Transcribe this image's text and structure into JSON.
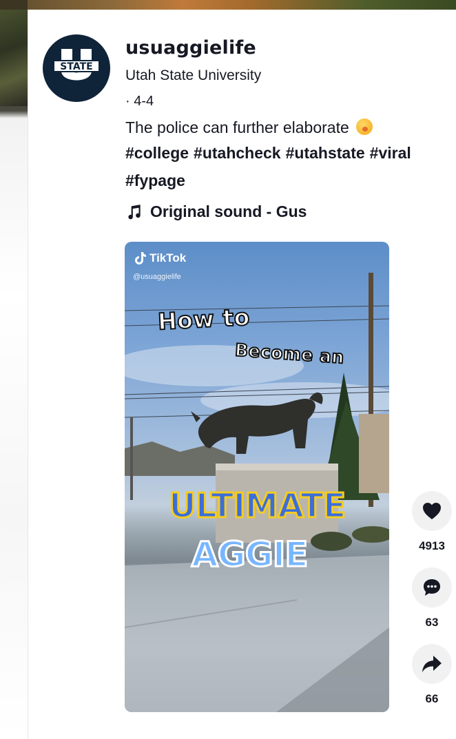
{
  "post": {
    "username": "usuaggielife",
    "display_name": "Utah State University",
    "date": "· 4-4",
    "caption": "The police can further elaborate",
    "emoji": "blushing-face-emoji",
    "hashtags_line1": [
      "#college",
      "#utahcheck",
      "#utahstate",
      "#viral"
    ],
    "hashtags_line2": [
      "#fypage"
    ],
    "music": "Original sound - Gus",
    "avatar_text": "STATE"
  },
  "video": {
    "brand": "TikTok",
    "handle": "@usuaggielife",
    "overlay_line1": "How to",
    "overlay_line2": "Become an",
    "overlay_line3": "ULTIMATE",
    "overlay_line4": "AGGIE"
  },
  "actions": {
    "like_count": "4913",
    "comment_count": "63",
    "share_count": "66"
  },
  "colors": {
    "avatar_bg": "#0f2439",
    "text": "#161823",
    "action_bg": "#f1f1f2"
  }
}
